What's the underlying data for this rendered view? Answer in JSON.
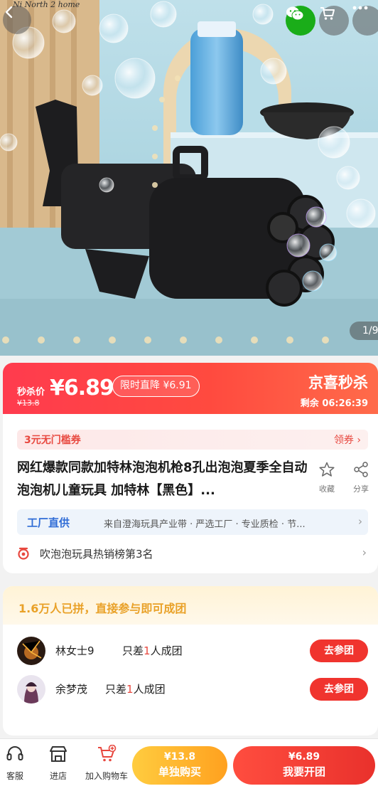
{
  "hero": {
    "brand_mark": "Ni North 2 home",
    "image_counter": "1/9"
  },
  "price_bar": {
    "sale_label": "秒杀价",
    "sale_price": "¥6.89",
    "original_price": "¥13.8",
    "limited_tag": "限时直降 ¥6.91",
    "flash_title": "京喜秒杀",
    "countdown": "剩余 06:26:39"
  },
  "info": {
    "coupon_label": "3元无门槛券",
    "coupon_get": "领券 ›",
    "title": "网红爆款同款加特林泡泡机枪8孔出泡泡夏季全自动泡泡机儿童玩具 加特林【黑色】...",
    "follow_label": "收藏",
    "share_label": "分享",
    "factory_tag": "工厂直供",
    "factory_desc": "来自澄海玩具产业带 · 严选工厂 · 专业质检 · 节...",
    "factory_arrow": "›",
    "rank_text": "吹泡泡玩具热销榜第3名",
    "rank_arrow": "›"
  },
  "group": {
    "count_text": "1.6万人已拼，直接参与即可成团",
    "rows": [
      {
        "user": "林女士9",
        "need_prefix": "只差",
        "need_num": "1",
        "need_suffix": "人成团",
        "button": "去参团"
      },
      {
        "user": "余梦茂",
        "need_prefix": "只差",
        "need_num": "1",
        "need_suffix": "人成团",
        "button": "去参团"
      }
    ]
  },
  "bottom_bar": {
    "service_label": "客服",
    "shop_label": "进店",
    "cart_label": "加入购物车",
    "solo_price": "¥13.8",
    "solo_label": "单独购买",
    "group_price": "¥6.89",
    "group_label": "我要开团"
  },
  "colors": {
    "accent_red": "#f0342e",
    "wechat_green": "#1aad19",
    "factory_blue": "#2f6cd6",
    "group_gold": "#e9a128",
    "solo_orange": "#ffa11f"
  },
  "icons": [
    "back-arrow-icon",
    "wechat-icon",
    "cart-icon",
    "more-dots-icon",
    "star-icon",
    "share-icon",
    "rank-badge-icon",
    "headset-icon",
    "shop-icon",
    "cart-add-icon"
  ]
}
